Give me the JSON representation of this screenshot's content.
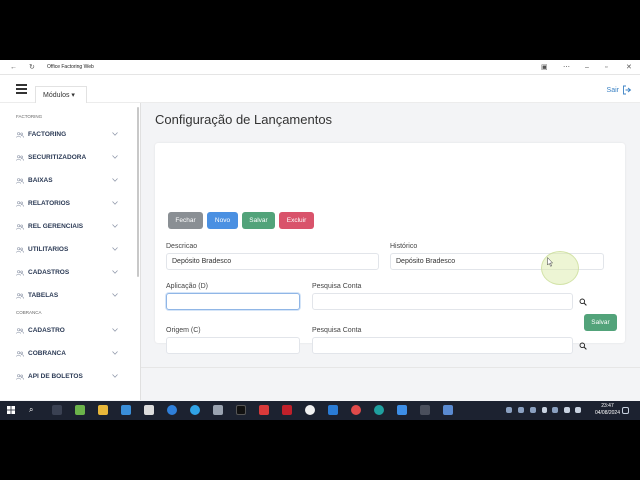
{
  "window": {
    "title": "Office Factoring Web"
  },
  "header": {
    "modules_label": "Módulos",
    "logout_label": "Sair"
  },
  "sidebar": {
    "sections": [
      {
        "label": "FACTORING",
        "items": [
          "FACTORING",
          "SECURITIZADORA",
          "BAIXAS",
          "RELATORIOS",
          "REL GERENCIAIS",
          "UTILITARIOS",
          "CADASTROS",
          "TABELAS"
        ]
      },
      {
        "label": "COBRANCA",
        "items": [
          "CADASTRO",
          "COBRANCA",
          "API DE BOLETOS"
        ]
      }
    ]
  },
  "page": {
    "title": "Configuração de Lançamentos"
  },
  "toolbar": {
    "fechar": "Fechar",
    "novo": "Novo",
    "salvar": "Salvar",
    "excluir": "Excluir"
  },
  "form": {
    "descricao_label": "Descricao",
    "descricao_value": "Depósito Bradesco",
    "historico_label": "Histórico",
    "historico_value": "Depósito Bradesco",
    "aplicacao_label": "Aplicação (D)",
    "aplicacao_value": "",
    "pesquisa_conta_label": "Pesquisa Conta",
    "pesquisa_conta_value": "",
    "origem_label": "Origem (C)",
    "origem_value": "",
    "pesquisa_conta2_label": "Pesquisa Conta",
    "pesquisa_conta2_value": "",
    "save_label": "Salvar"
  },
  "colors": {
    "fechar": "#8a8f94",
    "novo": "#4a90e2",
    "salvar": "#52a37a",
    "excluir": "#d9536b",
    "link": "#3b82c4"
  },
  "taskbar": {
    "time": "23:47",
    "date": "04/08/2024"
  }
}
